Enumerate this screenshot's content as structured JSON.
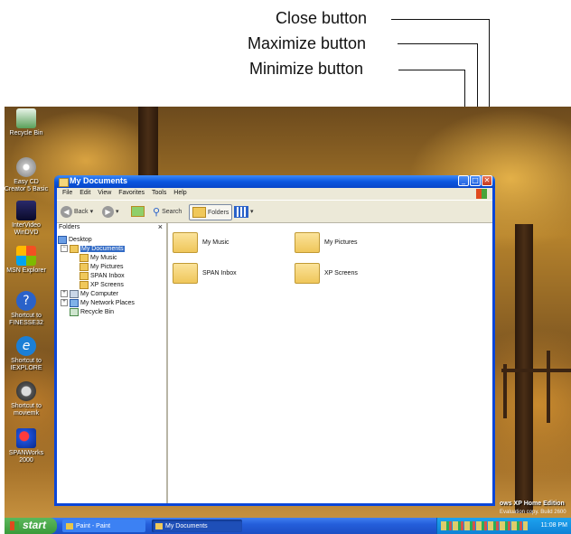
{
  "callouts": [
    {
      "label": "Close button"
    },
    {
      "label": "Maximize button"
    },
    {
      "label": "Minimize button"
    }
  ],
  "desktop_icons": [
    {
      "label": "Recycle Bin",
      "icon": "recycle-bin-icon"
    },
    {
      "label": "Easy CD Creator 5 Basic",
      "icon": "cd-creator-icon"
    },
    {
      "label": "InterVideo WinDVD",
      "icon": "windvd-icon"
    },
    {
      "label": "MSN Explorer",
      "icon": "msn-icon"
    },
    {
      "label": "Shortcut to FINESSE32",
      "icon": "help-icon"
    },
    {
      "label": "Shortcut to IEXPLORE",
      "icon": "internet-explorer-icon"
    },
    {
      "label": "Shortcut to moviemk",
      "icon": "movie-maker-icon"
    },
    {
      "label": "SPANWorks 2000",
      "icon": "spanworks-icon"
    }
  ],
  "window": {
    "title": "My Documents",
    "menu": [
      "File",
      "Edit",
      "View",
      "Favorites",
      "Tools",
      "Help"
    ],
    "toolbar": {
      "back": "Back",
      "search": "Search",
      "folders": "Folders"
    },
    "folders_pane": {
      "header": "Folders",
      "close": "×",
      "tree": [
        {
          "label": "Desktop",
          "level": 0
        },
        {
          "label": "My Documents",
          "level": 1,
          "selected": true
        },
        {
          "label": "My Music",
          "level": 2
        },
        {
          "label": "My Pictures",
          "level": 2
        },
        {
          "label": "SPAN Inbox",
          "level": 2
        },
        {
          "label": "XP Screens",
          "level": 2
        },
        {
          "label": "My Computer",
          "level": 1
        },
        {
          "label": "My Network Places",
          "level": 1
        },
        {
          "label": "Recycle Bin",
          "level": 1
        }
      ]
    },
    "items": [
      {
        "label": "My Music"
      },
      {
        "label": "My Pictures"
      },
      {
        "label": "SPAN Inbox"
      },
      {
        "label": "XP Screens"
      }
    ]
  },
  "watermark": {
    "line1": "ows XP Home Edition",
    "line2": "Evaluation copy. Build 2600"
  },
  "taskbar": {
    "start": "start",
    "tasks": [
      "Paint - Paint",
      "My Documents"
    ],
    "clock": "11:08 PM"
  },
  "colors": {
    "title_bar": "#0a56e0",
    "close_button": "#c4391f",
    "taskbar": "#245edb",
    "start_button": "#3a9a3a"
  }
}
